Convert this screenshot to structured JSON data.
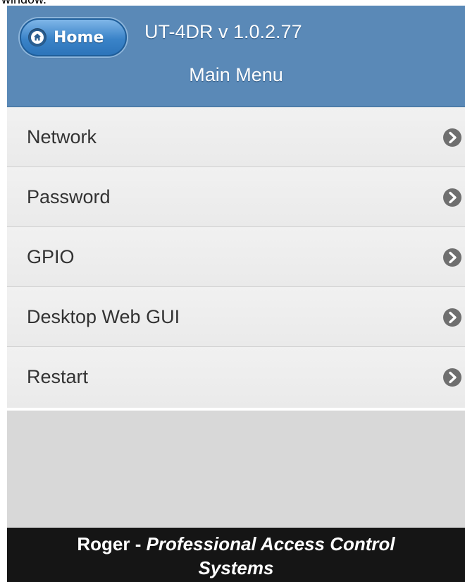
{
  "window": {
    "title": "window."
  },
  "header": {
    "home_label": "Home",
    "app_title": "UT-4DR v 1.0.2.77",
    "page_title": "Main Menu",
    "colors": {
      "bar": "#5a89b7",
      "home_button": "#3a83c8"
    }
  },
  "menu": {
    "items": [
      {
        "label": "Network",
        "icon": "chevron-right-circle-icon"
      },
      {
        "label": "Password",
        "icon": "chevron-right-circle-icon"
      },
      {
        "label": "GPIO",
        "icon": "chevron-right-circle-icon"
      },
      {
        "label": "Desktop Web GUI",
        "icon": "chevron-right-circle-icon"
      },
      {
        "label": "Restart",
        "icon": "chevron-right-circle-icon"
      }
    ]
  },
  "footer": {
    "brand": "Roger",
    "separator": " - ",
    "tagline_part1": "Professional Access Control",
    "tagline_part2": "Systems"
  }
}
